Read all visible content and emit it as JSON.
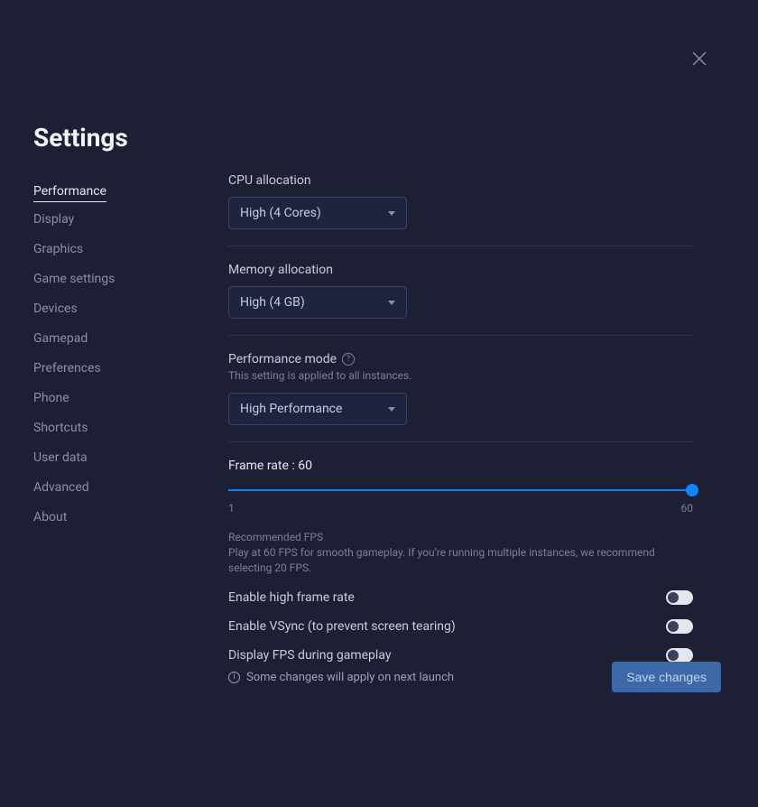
{
  "title": "Settings",
  "sidebar": {
    "items": [
      {
        "label": "Performance",
        "active": true
      },
      {
        "label": "Display"
      },
      {
        "label": "Graphics"
      },
      {
        "label": "Game settings"
      },
      {
        "label": "Devices"
      },
      {
        "label": "Gamepad"
      },
      {
        "label": "Preferences"
      },
      {
        "label": "Phone"
      },
      {
        "label": "Shortcuts"
      },
      {
        "label": "User data"
      },
      {
        "label": "Advanced"
      },
      {
        "label": "About"
      }
    ]
  },
  "cpu": {
    "label": "CPU allocation",
    "value": "High (4 Cores)"
  },
  "mem": {
    "label": "Memory allocation",
    "value": "High (4 GB)"
  },
  "perf_mode": {
    "label": "Performance mode",
    "note": "This setting is applied to all instances.",
    "value": "High Performance"
  },
  "frame_rate": {
    "label": "Frame rate : 60",
    "min": "1",
    "max": "60",
    "rec_title": "Recommended FPS",
    "rec_desc": "Play at 60 FPS for smooth gameplay. If you're running multiple instances, we recommend selecting 20 FPS."
  },
  "toggles": {
    "high_fps": "Enable high frame rate",
    "vsync": "Enable VSync (to prevent screen tearing)",
    "display_fps": "Display FPS during gameplay"
  },
  "footer": {
    "info": "Some changes will apply on next launch",
    "save": "Save changes"
  }
}
